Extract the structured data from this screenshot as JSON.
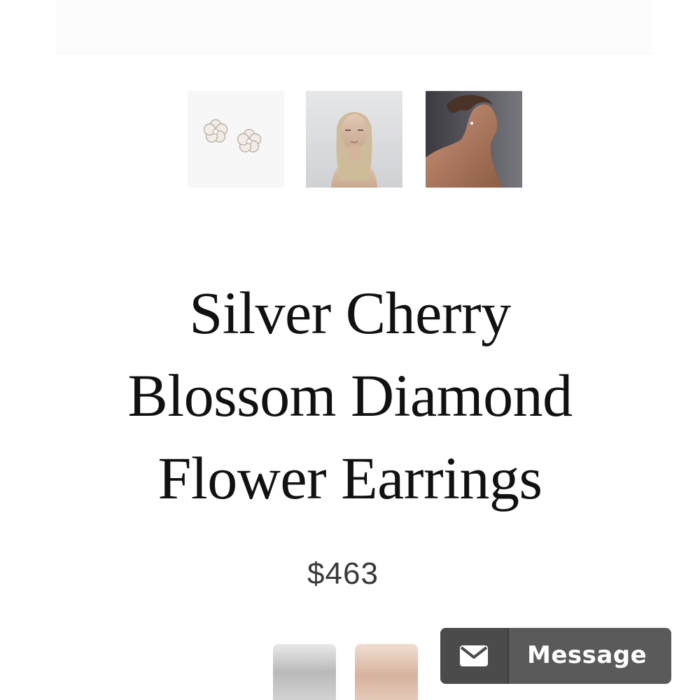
{
  "product": {
    "title_line_1": "Silver Cherry",
    "title_line_2": "Blossom Diamond",
    "title_line_3": "Flower Earrings",
    "price": "$463"
  },
  "gallery": {
    "thumbnails": [
      {
        "subject": "earrings-product-photo"
      },
      {
        "subject": "model-front-portrait"
      },
      {
        "subject": "model-side-profile"
      }
    ]
  },
  "swatches": [
    {
      "metal": "silver",
      "color": "#c8c8c8"
    },
    {
      "metal": "rose-gold",
      "color": "#ddbba6"
    }
  ],
  "message_button": {
    "label": "Message",
    "icon": "envelope-icon",
    "background": "#5a5a5a"
  }
}
